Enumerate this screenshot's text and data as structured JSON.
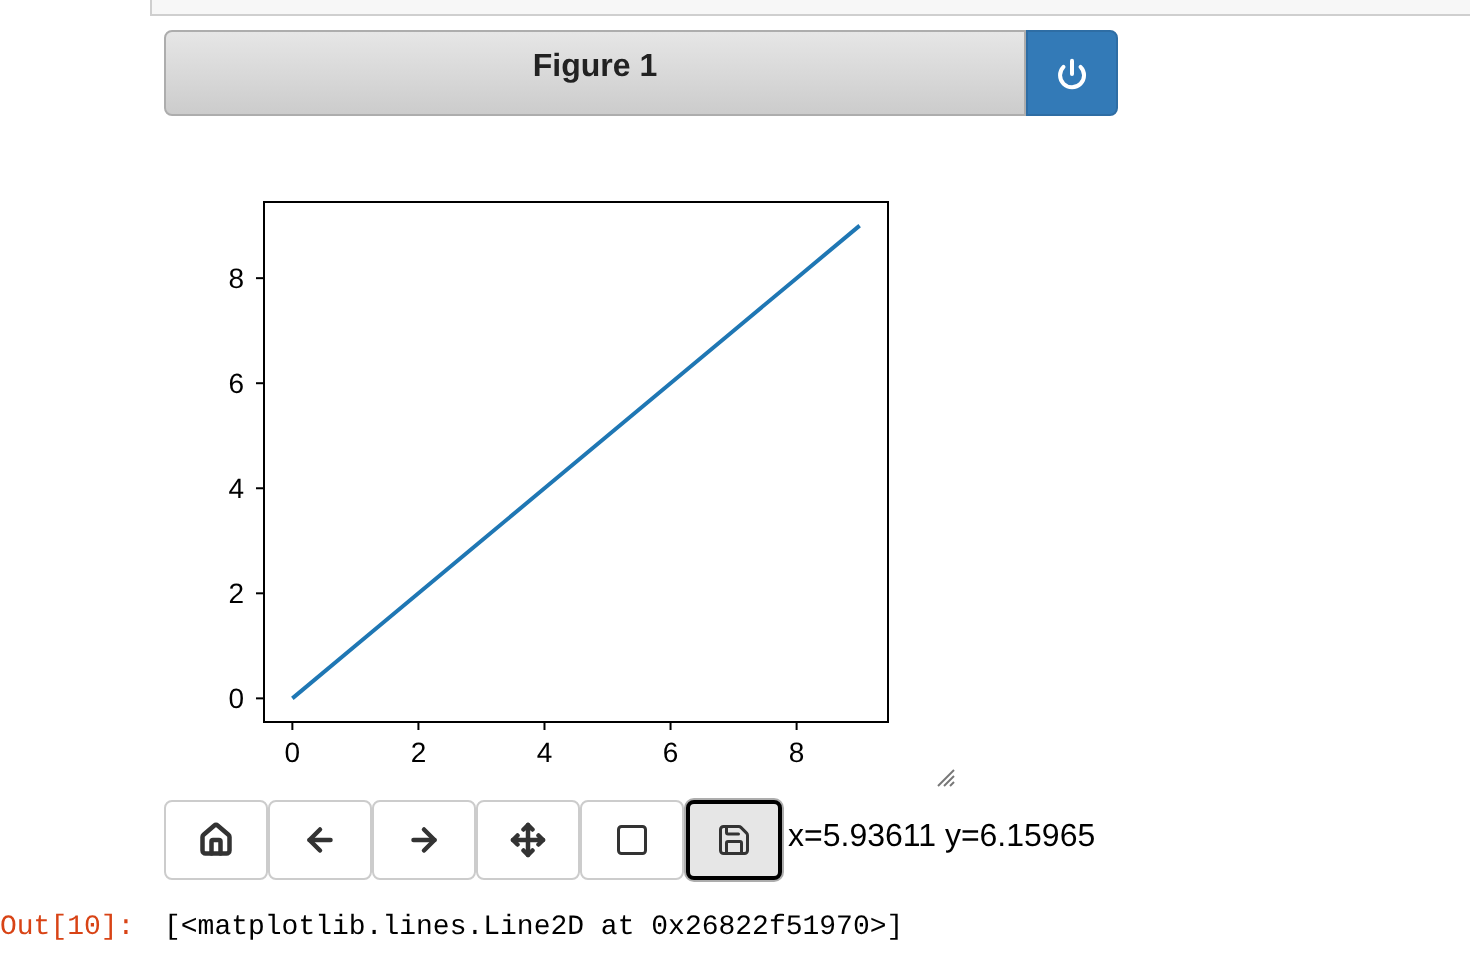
{
  "figure": {
    "title": "Figure 1",
    "chart_data": {
      "type": "line",
      "x": [
        0,
        1,
        2,
        3,
        4,
        5,
        6,
        7,
        8,
        9
      ],
      "series": [
        {
          "color": "#1f77b4",
          "values": [
            0,
            1,
            2,
            3,
            4,
            5,
            6,
            7,
            8,
            9
          ]
        }
      ],
      "xlim": [
        -0.45,
        9.45
      ],
      "ylim": [
        -0.45,
        9.45
      ],
      "xticks": [
        0,
        2,
        4,
        6,
        8
      ],
      "yticks": [
        0,
        2,
        4,
        6,
        8
      ]
    }
  },
  "toolbar": {
    "buttons": [
      {
        "kind": "home",
        "selected": false
      },
      {
        "kind": "back",
        "selected": false
      },
      {
        "kind": "forward",
        "selected": false
      },
      {
        "kind": "pan",
        "selected": false
      },
      {
        "kind": "zoom",
        "selected": false
      },
      {
        "kind": "save",
        "selected": true
      }
    ]
  },
  "coordinates": "x=5.93611 y=6.15965",
  "output": {
    "prompt": "Out[10]:",
    "text": "[<matplotlib.lines.Line2D at 0x26822f51970>]"
  }
}
